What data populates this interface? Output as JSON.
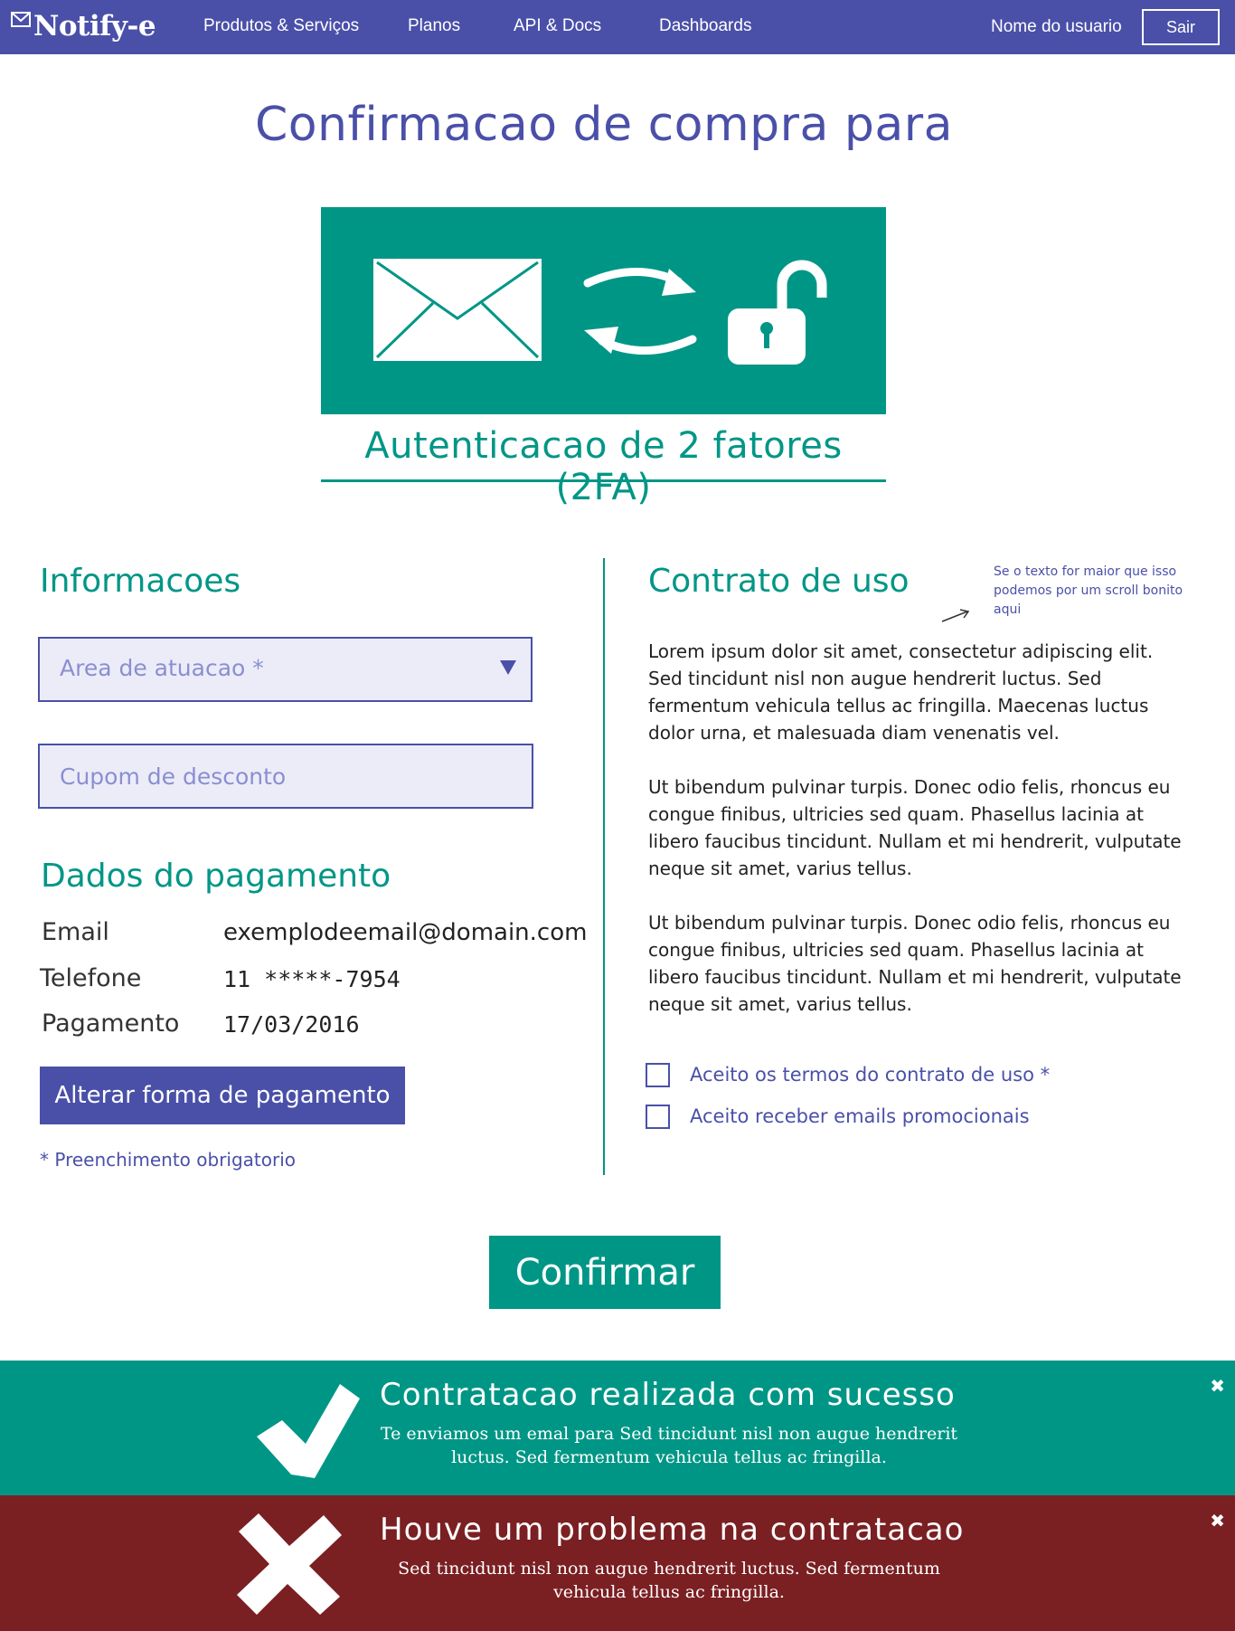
{
  "navbar": {
    "brand": "Notify-e",
    "links": [
      "Produtos & Serviços",
      "Planos",
      "API & Docs",
      "Dashboards"
    ],
    "user_name": "Nome do usuario",
    "logout_label": "Sair"
  },
  "page": {
    "title": "Confirmacao de compra para",
    "hero_caption": "Autenticacao de 2 fatores (2FA)"
  },
  "info_section": {
    "title": "Informacoes",
    "area_placeholder": "Area de atuacao *",
    "coupon_placeholder": "Cupom de desconto"
  },
  "payment_section": {
    "title": "Dados do pagamento",
    "rows": [
      {
        "label": "Email",
        "value": "exemplodeemail@domain.com"
      },
      {
        "label": "Telefone",
        "value": "11 *****-7954"
      },
      {
        "label": "Pagamento",
        "value": "17/03/2016"
      }
    ],
    "change_button": "Alterar forma de pagamento",
    "required_note": "* Preenchimento obrigatorio"
  },
  "contract_section": {
    "title": "Contrato de uso",
    "annotation": "Se o texto for maior que isso podemos por um scroll bonito aqui",
    "paragraphs": [
      "Lorem ipsum dolor sit amet, consectetur adipiscing elit. Sed tincidunt nisl non augue hendrerit luctus. Sed fermentum vehicula tellus ac fringilla. Maecenas luctus dolor urna, et malesuada diam venenatis vel.",
      "Ut bibendum pulvinar turpis. Donec odio felis, rhoncus eu congue finibus, ultricies sed quam. Phasellus lacinia at libero faucibus tincidunt. Nullam et mi hendrerit, vulputate neque sit amet, varius tellus.",
      "Ut bibendum pulvinar turpis. Donec odio felis, rhoncus eu congue finibus, ultricies sed quam. Phasellus lacinia at libero faucibus tincidunt. Nullam et mi hendrerit, vulputate neque sit amet, varius tellus."
    ],
    "checkboxes": [
      "Aceito os termos do contrato de uso *",
      "Aceito receber emails promocionais"
    ]
  },
  "confirm_label": "Confirmar",
  "alerts": {
    "success": {
      "title": "Contratacao realizada com sucesso",
      "message": "Te enviamos um emal para Sed tincidunt nisl non augue hendrerit luctus. Sed fermentum vehicula tellus ac fringilla.",
      "close": "✖"
    },
    "error": {
      "title": "Houve um problema na contratacao",
      "message": "Sed tincidunt nisl non augue hendrerit luctus. Sed fermentum vehicula tellus ac fringilla.",
      "close": "✖"
    }
  },
  "colors": {
    "primary": "#4a50a8",
    "teal": "#009686",
    "error": "#7a1f22",
    "input_bg": "#ececf9"
  },
  "icons": [
    "envelope-icon",
    "sync-icon",
    "unlock-icon",
    "check-icon",
    "cross-icon",
    "close-icon",
    "chevron-down-icon"
  ]
}
